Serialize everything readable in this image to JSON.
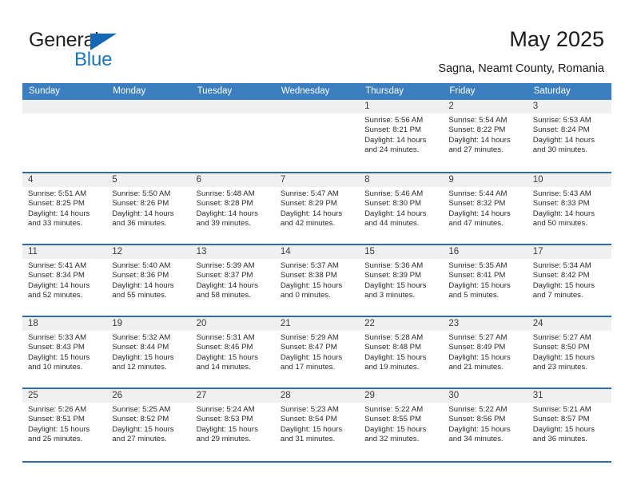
{
  "brand": {
    "name_part1": "General",
    "name_part2": "Blue",
    "logo_icon": "triangle-icon",
    "color_dark": "#231f20",
    "color_blue": "#1b75bb"
  },
  "header": {
    "title": "May 2025",
    "location": "Sagna, Neamt County, Romania"
  },
  "theme": {
    "header_bg": "#3c7fc1",
    "row_divider": "#2e6da4",
    "daynum_bg": "#f0f0f0"
  },
  "calendar": {
    "day_headers": [
      "Sunday",
      "Monday",
      "Tuesday",
      "Wednesday",
      "Thursday",
      "Friday",
      "Saturday"
    ],
    "weeks": [
      [
        {
          "day": "",
          "empty": true
        },
        {
          "day": "",
          "empty": true
        },
        {
          "day": "",
          "empty": true
        },
        {
          "day": "",
          "empty": true
        },
        {
          "day": "1",
          "sunrise": "Sunrise: 5:56 AM",
          "sunset": "Sunset: 8:21 PM",
          "daylight1": "Daylight: 14 hours",
          "daylight2": "and 24 minutes."
        },
        {
          "day": "2",
          "sunrise": "Sunrise: 5:54 AM",
          "sunset": "Sunset: 8:22 PM",
          "daylight1": "Daylight: 14 hours",
          "daylight2": "and 27 minutes."
        },
        {
          "day": "3",
          "sunrise": "Sunrise: 5:53 AM",
          "sunset": "Sunset: 8:24 PM",
          "daylight1": "Daylight: 14 hours",
          "daylight2": "and 30 minutes."
        }
      ],
      [
        {
          "day": "4",
          "sunrise": "Sunrise: 5:51 AM",
          "sunset": "Sunset: 8:25 PM",
          "daylight1": "Daylight: 14 hours",
          "daylight2": "and 33 minutes."
        },
        {
          "day": "5",
          "sunrise": "Sunrise: 5:50 AM",
          "sunset": "Sunset: 8:26 PM",
          "daylight1": "Daylight: 14 hours",
          "daylight2": "and 36 minutes."
        },
        {
          "day": "6",
          "sunrise": "Sunrise: 5:48 AM",
          "sunset": "Sunset: 8:28 PM",
          "daylight1": "Daylight: 14 hours",
          "daylight2": "and 39 minutes."
        },
        {
          "day": "7",
          "sunrise": "Sunrise: 5:47 AM",
          "sunset": "Sunset: 8:29 PM",
          "daylight1": "Daylight: 14 hours",
          "daylight2": "and 42 minutes."
        },
        {
          "day": "8",
          "sunrise": "Sunrise: 5:46 AM",
          "sunset": "Sunset: 8:30 PM",
          "daylight1": "Daylight: 14 hours",
          "daylight2": "and 44 minutes."
        },
        {
          "day": "9",
          "sunrise": "Sunrise: 5:44 AM",
          "sunset": "Sunset: 8:32 PM",
          "daylight1": "Daylight: 14 hours",
          "daylight2": "and 47 minutes."
        },
        {
          "day": "10",
          "sunrise": "Sunrise: 5:43 AM",
          "sunset": "Sunset: 8:33 PM",
          "daylight1": "Daylight: 14 hours",
          "daylight2": "and 50 minutes."
        }
      ],
      [
        {
          "day": "11",
          "sunrise": "Sunrise: 5:41 AM",
          "sunset": "Sunset: 8:34 PM",
          "daylight1": "Daylight: 14 hours",
          "daylight2": "and 52 minutes."
        },
        {
          "day": "12",
          "sunrise": "Sunrise: 5:40 AM",
          "sunset": "Sunset: 8:36 PM",
          "daylight1": "Daylight: 14 hours",
          "daylight2": "and 55 minutes."
        },
        {
          "day": "13",
          "sunrise": "Sunrise: 5:39 AM",
          "sunset": "Sunset: 8:37 PM",
          "daylight1": "Daylight: 14 hours",
          "daylight2": "and 58 minutes."
        },
        {
          "day": "14",
          "sunrise": "Sunrise: 5:37 AM",
          "sunset": "Sunset: 8:38 PM",
          "daylight1": "Daylight: 15 hours",
          "daylight2": "and 0 minutes."
        },
        {
          "day": "15",
          "sunrise": "Sunrise: 5:36 AM",
          "sunset": "Sunset: 8:39 PM",
          "daylight1": "Daylight: 15 hours",
          "daylight2": "and 3 minutes."
        },
        {
          "day": "16",
          "sunrise": "Sunrise: 5:35 AM",
          "sunset": "Sunset: 8:41 PM",
          "daylight1": "Daylight: 15 hours",
          "daylight2": "and 5 minutes."
        },
        {
          "day": "17",
          "sunrise": "Sunrise: 5:34 AM",
          "sunset": "Sunset: 8:42 PM",
          "daylight1": "Daylight: 15 hours",
          "daylight2": "and 7 minutes."
        }
      ],
      [
        {
          "day": "18",
          "sunrise": "Sunrise: 5:33 AM",
          "sunset": "Sunset: 8:43 PM",
          "daylight1": "Daylight: 15 hours",
          "daylight2": "and 10 minutes."
        },
        {
          "day": "19",
          "sunrise": "Sunrise: 5:32 AM",
          "sunset": "Sunset: 8:44 PM",
          "daylight1": "Daylight: 15 hours",
          "daylight2": "and 12 minutes."
        },
        {
          "day": "20",
          "sunrise": "Sunrise: 5:31 AM",
          "sunset": "Sunset: 8:45 PM",
          "daylight1": "Daylight: 15 hours",
          "daylight2": "and 14 minutes."
        },
        {
          "day": "21",
          "sunrise": "Sunrise: 5:29 AM",
          "sunset": "Sunset: 8:47 PM",
          "daylight1": "Daylight: 15 hours",
          "daylight2": "and 17 minutes."
        },
        {
          "day": "22",
          "sunrise": "Sunrise: 5:28 AM",
          "sunset": "Sunset: 8:48 PM",
          "daylight1": "Daylight: 15 hours",
          "daylight2": "and 19 minutes."
        },
        {
          "day": "23",
          "sunrise": "Sunrise: 5:27 AM",
          "sunset": "Sunset: 8:49 PM",
          "daylight1": "Daylight: 15 hours",
          "daylight2": "and 21 minutes."
        },
        {
          "day": "24",
          "sunrise": "Sunrise: 5:27 AM",
          "sunset": "Sunset: 8:50 PM",
          "daylight1": "Daylight: 15 hours",
          "daylight2": "and 23 minutes."
        }
      ],
      [
        {
          "day": "25",
          "sunrise": "Sunrise: 5:26 AM",
          "sunset": "Sunset: 8:51 PM",
          "daylight1": "Daylight: 15 hours",
          "daylight2": "and 25 minutes."
        },
        {
          "day": "26",
          "sunrise": "Sunrise: 5:25 AM",
          "sunset": "Sunset: 8:52 PM",
          "daylight1": "Daylight: 15 hours",
          "daylight2": "and 27 minutes."
        },
        {
          "day": "27",
          "sunrise": "Sunrise: 5:24 AM",
          "sunset": "Sunset: 8:53 PM",
          "daylight1": "Daylight: 15 hours",
          "daylight2": "and 29 minutes."
        },
        {
          "day": "28",
          "sunrise": "Sunrise: 5:23 AM",
          "sunset": "Sunset: 8:54 PM",
          "daylight1": "Daylight: 15 hours",
          "daylight2": "and 31 minutes."
        },
        {
          "day": "29",
          "sunrise": "Sunrise: 5:22 AM",
          "sunset": "Sunset: 8:55 PM",
          "daylight1": "Daylight: 15 hours",
          "daylight2": "and 32 minutes."
        },
        {
          "day": "30",
          "sunrise": "Sunrise: 5:22 AM",
          "sunset": "Sunset: 8:56 PM",
          "daylight1": "Daylight: 15 hours",
          "daylight2": "and 34 minutes."
        },
        {
          "day": "31",
          "sunrise": "Sunrise: 5:21 AM",
          "sunset": "Sunset: 8:57 PM",
          "daylight1": "Daylight: 15 hours",
          "daylight2": "and 36 minutes."
        }
      ]
    ]
  }
}
